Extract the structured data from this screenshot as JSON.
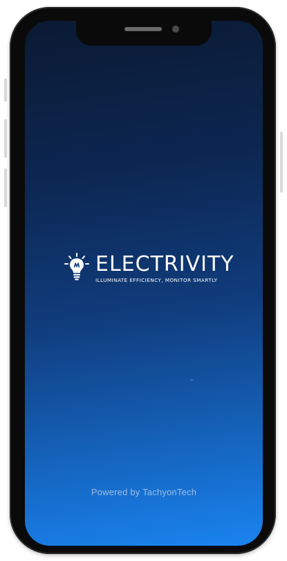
{
  "splash": {
    "brand_name": "ELECTRIVITY",
    "tagline": "ILLUMINATE EFFICIENCY, MONITOR SMARTLY",
    "powered_by": "Powered by TachyonTech",
    "logo_icon": "lightbulb-icon"
  },
  "colors": {
    "gradient_top": "#0b1a33",
    "gradient_bottom": "#1a84f0",
    "text": "#ffffff"
  }
}
